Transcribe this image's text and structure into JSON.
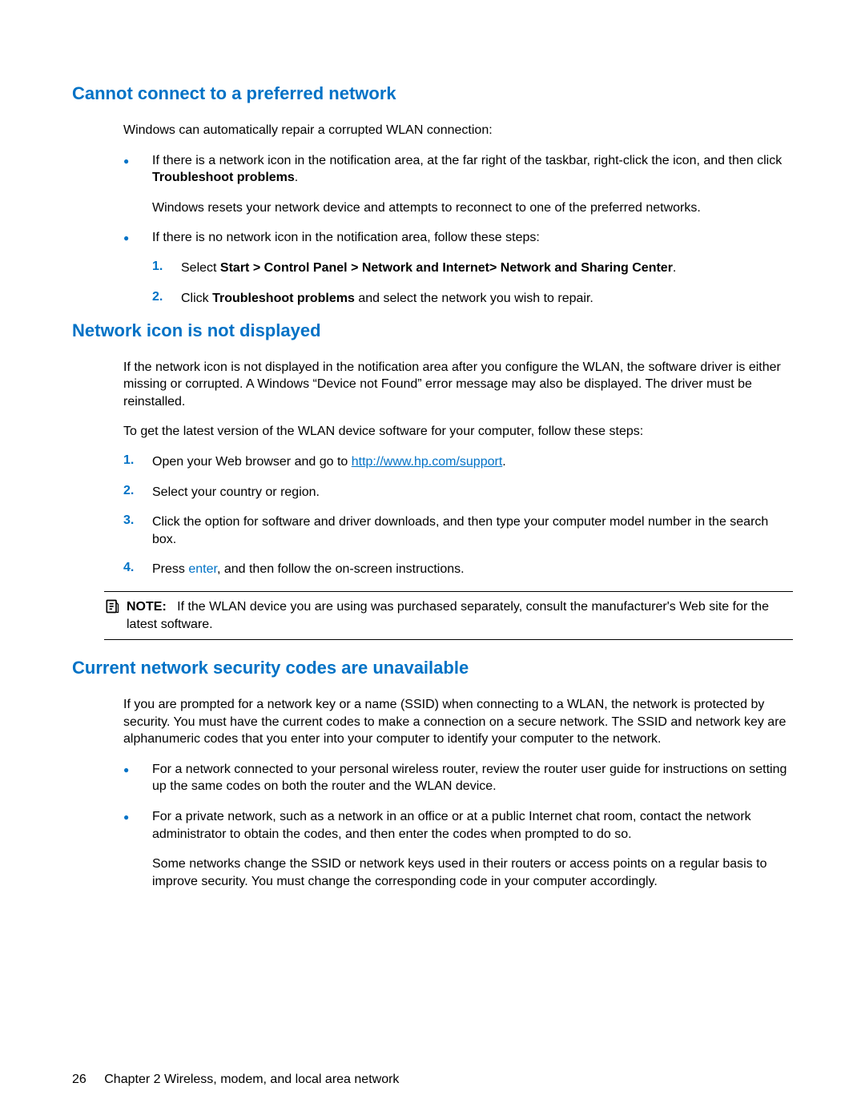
{
  "section1": {
    "heading": "Cannot connect to a preferred network",
    "intro": "Windows can automatically repair a corrupted WLAN connection:",
    "bullet1_a": "If there is a network icon in the notification area, at the far right of the taskbar, right-click the icon, and then click ",
    "bullet1_bold": "Troubleshoot problems",
    "bullet1_b": ".",
    "bullet1_sub": "Windows resets your network device and attempts to reconnect to one of the preferred networks.",
    "bullet2": "If there is no network icon in the notification area, follow these steps:",
    "ol1_num": "1.",
    "ol1_a": "Select ",
    "ol1_bold": "Start > Control Panel > Network and Internet> Network and Sharing Center",
    "ol1_b": ".",
    "ol2_num": "2.",
    "ol2_a": "Click ",
    "ol2_bold": "Troubleshoot problems",
    "ol2_b": " and select the network you wish to repair."
  },
  "section2": {
    "heading": "Network icon is not displayed",
    "p1": "If the network icon is not displayed in the notification area after you configure the WLAN, the software driver is either missing or corrupted. A Windows “Device not Found” error message may also be displayed. The driver must be reinstalled.",
    "p2": "To get the latest version of the WLAN device software for your computer, follow these steps:",
    "ol1_num": "1.",
    "ol1_a": "Open your Web browser and go to ",
    "ol1_link": "http://www.hp.com/support",
    "ol1_b": ".",
    "ol2_num": "2.",
    "ol2": "Select your country or region.",
    "ol3_num": "3.",
    "ol3": "Click the option for software and driver downloads, and then type your computer model number in the search box.",
    "ol4_num": "4.",
    "ol4_a": "Press ",
    "ol4_key": "enter",
    "ol4_b": ", and then follow the on-screen instructions.",
    "note_label": "NOTE:",
    "note_text": "If the WLAN device you are using was purchased separately, consult the manufacturer's Web site for the latest software."
  },
  "section3": {
    "heading": "Current network security codes are unavailable",
    "p1": "If you are prompted for a network key or a name (SSID) when connecting to a WLAN, the network is protected by security. You must have the current codes to make a connection on a secure network. The SSID and network key are alphanumeric codes that you enter into your computer to identify your computer to the network.",
    "b1": "For a network connected to your personal wireless router, review the router user guide for instructions on setting up the same codes on both the router and the WLAN device.",
    "b2": "For a private network, such as a network in an office or at a public Internet chat room, contact the network administrator to obtain the codes, and then enter the codes when prompted to do so.",
    "b2_sub": "Some networks change the SSID or network keys used in their routers or access points on a regular basis to improve security. You must change the corresponding code in your computer accordingly."
  },
  "footer": {
    "page": "26",
    "chapter": "Chapter 2   Wireless, modem, and local area network"
  }
}
